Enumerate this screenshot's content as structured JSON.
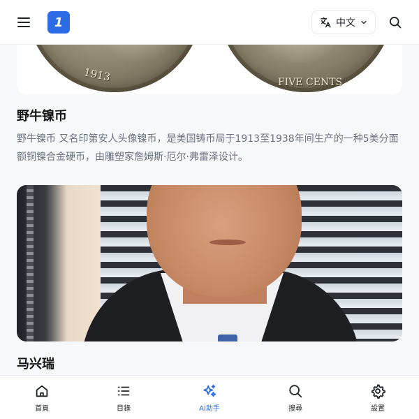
{
  "header": {
    "logo_text": "1",
    "language_label": "中文",
    "icons": [
      "menu-icon",
      "translate-icon",
      "chevron-down-icon",
      "search-icon"
    ]
  },
  "articles": [
    {
      "title": "野牛镍币",
      "description": "野牛镍币 又名印第安人头像镍币，是美国铸币局于1913至1938年间生产的一种5美分面额铜镍合金硬币，由雕塑家詹姆斯·厄尔·弗雷泽设计。",
      "image": {
        "type": "coin-pair",
        "left_coin_text": "1913",
        "right_coin_text": "FIVE CENTS"
      }
    },
    {
      "title": "马兴瑞",
      "image": {
        "type": "portrait-photo"
      }
    }
  ],
  "bottom_nav": {
    "items": [
      {
        "label": "首頁",
        "icon": "home-icon",
        "active": false
      },
      {
        "label": "目錄",
        "icon": "list-icon",
        "active": false
      },
      {
        "label": "AI助手",
        "icon": "sparkles-icon",
        "active": true
      },
      {
        "label": "搜尋",
        "icon": "search-icon",
        "active": false
      },
      {
        "label": "設置",
        "icon": "gear-icon",
        "active": false
      }
    ]
  },
  "colors": {
    "accent": "#2d6be4",
    "text_primary": "#111111",
    "text_secondary": "#6b7280",
    "background": "#f7f8fa"
  }
}
